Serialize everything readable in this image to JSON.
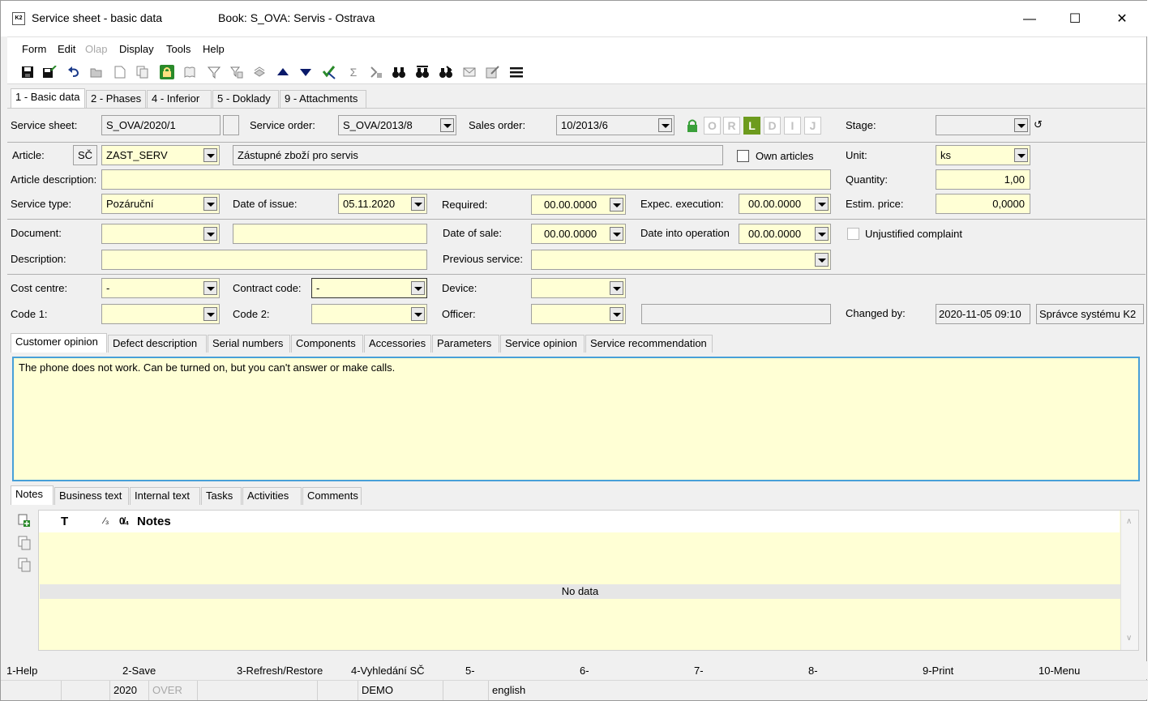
{
  "window": {
    "title": "Service sheet - basic data",
    "book": "Book: S_OVA: Servis - Ostrava",
    "app_icon": "K2",
    "controls": {
      "minimize": "—",
      "maximize": "☐",
      "close": "✕"
    }
  },
  "menu": [
    "Form",
    "Edit",
    "Olap",
    "Display",
    "Tools",
    "Help"
  ],
  "toolbar_icons": [
    "save-icon",
    "save-close-icon",
    "undo-icon",
    "open-folder-icon",
    "new-document-icon",
    "copy-document-icon",
    "lock-icon",
    "book-icon",
    "filter-icon",
    "filter-edit-icon",
    "layers-icon",
    "arrow-up-icon",
    "arrow-down-icon",
    "select-icon",
    "sum-icon",
    "bulk-icon",
    "binoculars-icon",
    "binoculars-next-icon",
    "binoculars-edit-icon",
    "mail-icon",
    "edit-note-icon",
    "menu-icon"
  ],
  "main_tabs": [
    "1 - Basic data",
    "2 - Phases",
    "4 - Inferior",
    "5 - Doklady",
    "9 - Attachments"
  ],
  "form": {
    "service_sheet": {
      "label": "Service sheet:",
      "value": "S_OVA/2020/1"
    },
    "service_order": {
      "label": "Service order:",
      "value": "S_OVA/2013/8"
    },
    "sales_order": {
      "label": "Sales order:",
      "value": "10/2013/6"
    },
    "flags": [
      "O",
      "R",
      "L",
      "D",
      "I",
      "J"
    ],
    "active_flag": "L",
    "stage": {
      "label": "Stage:",
      "value": ""
    },
    "article": {
      "label": "Article:",
      "prefix": "SČ",
      "value": "ZAST_SERV",
      "name": "Zástupné zboží pro servis"
    },
    "own_articles": {
      "label": "Own articles",
      "checked": false
    },
    "unit": {
      "label": "Unit:",
      "value": "ks"
    },
    "article_description": {
      "label": "Article description:",
      "value": ""
    },
    "quantity": {
      "label": "Quantity:",
      "value": "1,00"
    },
    "service_type": {
      "label": "Service type:",
      "value": "Pozáruční"
    },
    "date_of_issue": {
      "label": "Date of issue:",
      "value": "05.11.2020"
    },
    "required": {
      "label": "Required:",
      "value": "00.00.0000"
    },
    "expec_execution": {
      "label": "Expec. execution:",
      "value": "00.00.0000"
    },
    "estim_price": {
      "label": "Estim. price:",
      "value": "0,0000"
    },
    "document": {
      "label": "Document:",
      "value": "",
      "extra": ""
    },
    "date_of_sale": {
      "label": "Date of sale:",
      "value": "00.00.0000"
    },
    "date_into_operation": {
      "label": "Date into operation",
      "value": "00.00.0000"
    },
    "unjustified_complaint": {
      "label": "Unjustified complaint",
      "checked": false
    },
    "description": {
      "label": "Description:",
      "value": ""
    },
    "previous_service": {
      "label": "Previous service:",
      "value": ""
    },
    "cost_centre": {
      "label": "Cost centre:",
      "value": "-"
    },
    "contract_code": {
      "label": "Contract code:",
      "value": "-"
    },
    "device": {
      "label": "Device:",
      "value": ""
    },
    "code1": {
      "label": "Code 1:",
      "value": ""
    },
    "code2": {
      "label": "Code 2:",
      "value": ""
    },
    "officer": {
      "label": "Officer:",
      "value": "",
      "extra": ""
    },
    "changed_by": {
      "label": "Changed by:",
      "date": "2020-11-05 09:10",
      "user": "Správce systému K2"
    }
  },
  "detail_tabs": [
    "Customer opinion",
    "Defect description",
    "Serial numbers",
    "Components",
    "Accessories",
    "Parameters",
    "Service opinion",
    "Service recommendation"
  ],
  "customer_opinion": "The phone does not work. Can be turned on, but you can't answer or make calls.",
  "notes_tabs": [
    "Notes",
    "Business text",
    "Internal text",
    "Tasks",
    "Activities",
    "Comments"
  ],
  "notes_grid": {
    "columns": [
      "T",
      "⁄₃",
      "0̸₄",
      "Notes"
    ],
    "empty_text": "No data"
  },
  "function_keys": [
    "1-Help",
    "2-Save",
    "3-Refresh/Restore",
    "4-Vyhledání SČ",
    "5-",
    "6-",
    "7-",
    "8-",
    "9-Print",
    "10-Menu"
  ],
  "status": {
    "year": "2020",
    "mode": "OVER",
    "database": "DEMO",
    "language": "english"
  },
  "colors": {
    "field": "#ffffd5",
    "focus_border": "#48a0d8",
    "flag_active": "#6d9b1e"
  }
}
